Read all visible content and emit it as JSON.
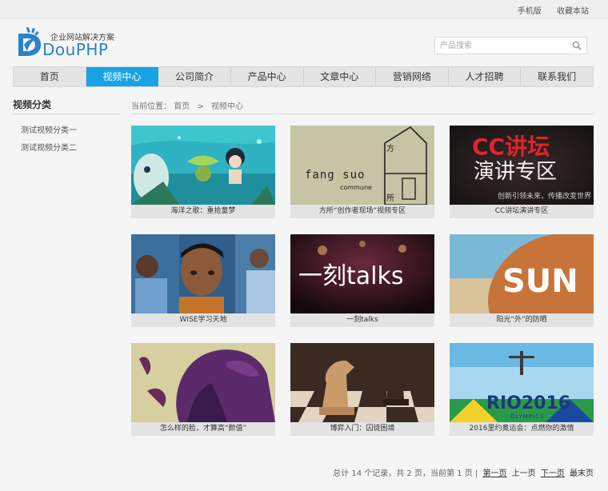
{
  "topbar": {
    "mobile": "手机版",
    "bookmark": "收藏本站"
  },
  "logo": {
    "tagline": "企业网站解决方案",
    "word": "DouPHP"
  },
  "search": {
    "placeholder": "产品搜索"
  },
  "nav": [
    "首页",
    "视频中心",
    "公司简介",
    "产品中心",
    "文章中心",
    "营销网络",
    "人才招聘",
    "联系我们"
  ],
  "nav_active": 1,
  "sidebar": {
    "title": "视频分类",
    "items": [
      "测试视频分类一",
      "测试视频分类二"
    ]
  },
  "breadcrumb": {
    "prefix": "当前位置：",
    "home": "首页",
    "sep": ">",
    "current": "视频中心"
  },
  "cards": [
    {
      "caption": "海洋之歌：重拾童梦"
    },
    {
      "caption": "方所“创作者现场”视频专区",
      "art_top": "方",
      "art_main": "fang suo",
      "art_sub": "commune",
      "art_bot": "所"
    },
    {
      "caption": "CC讲坛演讲专区",
      "art_title": "CC讲坛",
      "art_main": "演讲专区",
      "art_sub": "创新引领未来，传播改变世界"
    },
    {
      "caption": "WISE学习天地"
    },
    {
      "caption": "一刻talks",
      "art_main": "一刻talks"
    },
    {
      "caption": "阳光“外”的防晒",
      "art_main": "SUN"
    },
    {
      "caption": "怎么样的脸，才算高“颜值”"
    },
    {
      "caption": "博弈入门：囚徒困境"
    },
    {
      "caption": "2016里约奥运会：点燃你的激情",
      "art_main": "RIO2016",
      "art_sub": "OLYMPICS"
    }
  ],
  "pager": {
    "summary": "总计 14 个记录，共 2 页，当前第 1 页 |",
    "first": "第一页",
    "prev": "上一页",
    "next": "下一页",
    "last": "最末页"
  },
  "colors": {
    "accent": "#17a3e5",
    "logo": "#2a83c8"
  }
}
